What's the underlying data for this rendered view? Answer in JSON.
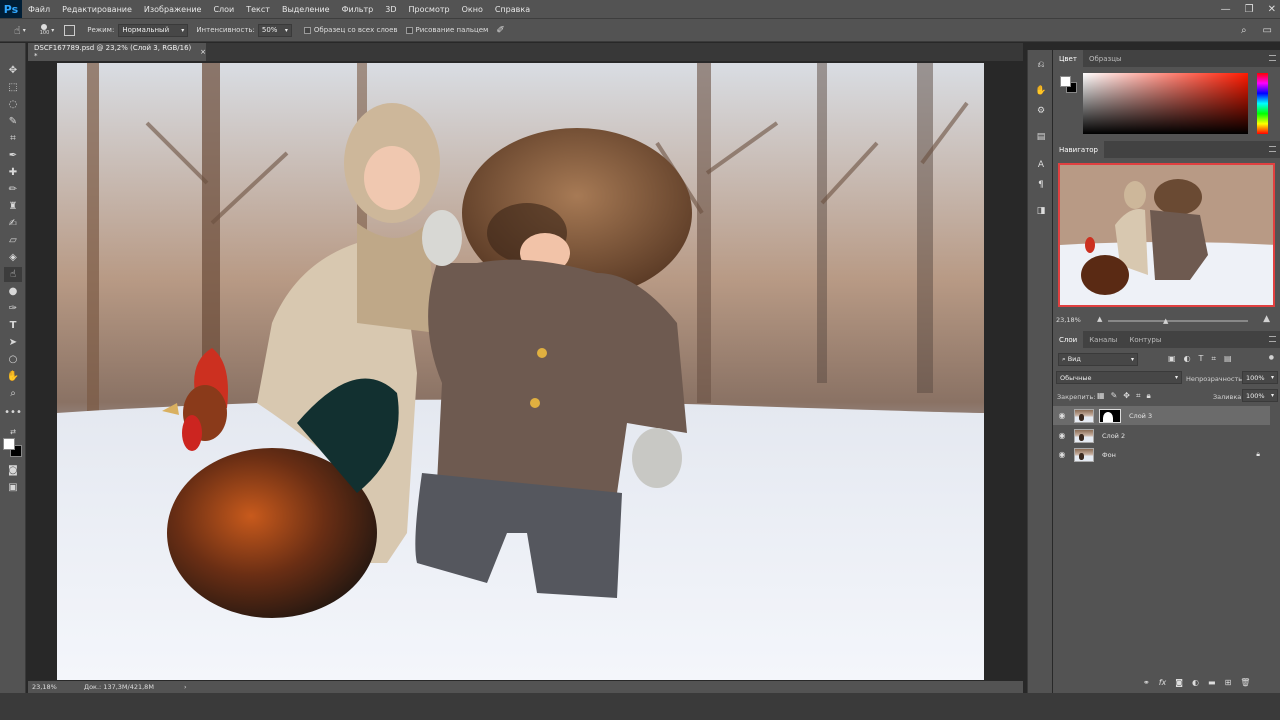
{
  "app": {
    "logo": "Ps"
  },
  "menu": [
    "Файл",
    "Редактирование",
    "Изображение",
    "Слои",
    "Текст",
    "Выделение",
    "Фильтр",
    "3D",
    "Просмотр",
    "Окно",
    "Справка"
  ],
  "options_bar": {
    "brush_size": "100",
    "mode_label": "Режим:",
    "mode_value": "Нормальный",
    "strength_label": "Интенсивность:",
    "strength_value": "50%",
    "sample_all_layers": "Образец со всех слоев",
    "finger_painting": "Рисование пальцем"
  },
  "document": {
    "tab_title": "DSCF167789.psd @ 23,2% (Слой 3, RGB/16) *",
    "close": "×"
  },
  "status": {
    "zoom": "23,18%",
    "doc_info": "Док.: 137,3M/421,8M",
    "arrow": "›"
  },
  "color_panel": {
    "tabs": [
      "Цвет",
      "Образцы"
    ],
    "foreground": "#ffffff",
    "background": "#000000",
    "hue": "#ff0000"
  },
  "navigator_panel": {
    "title": "Навигатор",
    "zoom": "23,18%"
  },
  "layers_panel": {
    "tabs": [
      "Слои",
      "Каналы",
      "Контуры"
    ],
    "filter_label": "Вид",
    "blend_mode": "Обычные",
    "opacity_label": "Непрозрачность:",
    "opacity_value": "100%",
    "lock_label": "Закрепить:",
    "fill_label": "Заливка:",
    "fill_value": "100%",
    "layers": [
      {
        "name": "Слой 3",
        "selected": true,
        "has_mask": true,
        "locked": false
      },
      {
        "name": "Слой 2",
        "selected": false,
        "has_mask": false,
        "locked": false
      },
      {
        "name": "Фон",
        "selected": false,
        "has_mask": false,
        "locked": true
      }
    ],
    "footer_icons": [
      "link-icon",
      "fx-icon",
      "mask-icon",
      "adjustment-icon",
      "folder-icon",
      "new-layer-icon",
      "trash-icon"
    ]
  }
}
